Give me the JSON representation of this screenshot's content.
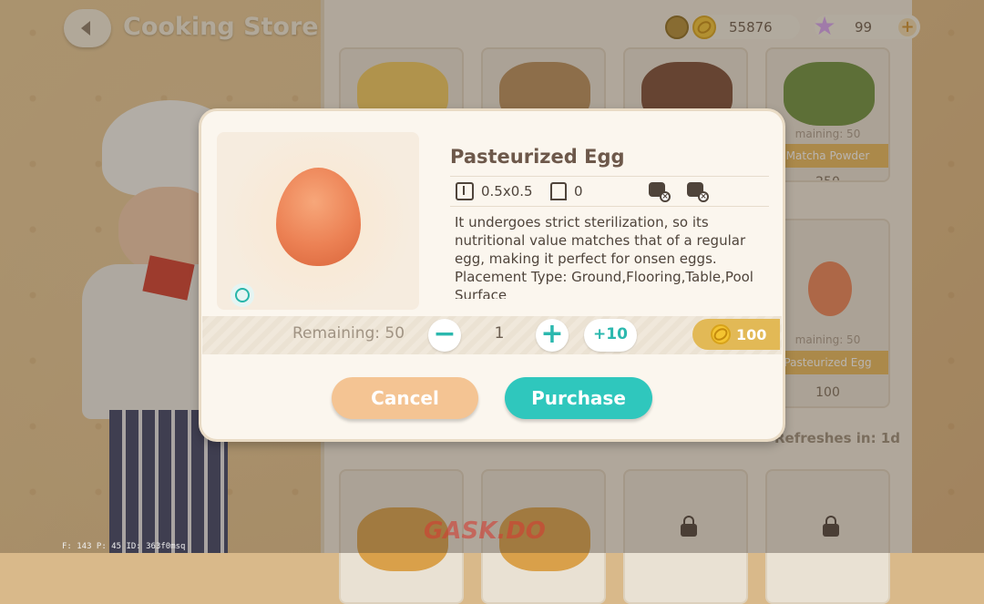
{
  "header": {
    "title": "Cooking Store"
  },
  "currency": {
    "coins": "55876",
    "stars": "99"
  },
  "shop": {
    "items": [
      {
        "name": "",
        "remaining": "",
        "price": ""
      },
      {
        "name": "",
        "remaining": "",
        "price": ""
      },
      {
        "name": "",
        "remaining": "",
        "price": ""
      },
      {
        "name": "Matcha Powder",
        "remaining": "maining: 50",
        "price": "250"
      },
      {
        "name": "Pasteurized Egg",
        "remaining": "maining: 50",
        "price": "100"
      }
    ],
    "refresh_label": "Refreshes in: 1d"
  },
  "modal": {
    "item_name": "Pasteurized Egg",
    "size": "0.5x0.5",
    "capacity": "0",
    "description": "It undergoes strict sterilization, so its nutritional value matches that of a regular egg, making it perfect for onsen eggs. Placement Type: Ground,Flooring,Table,Pool Surface",
    "remaining": "Remaining: 50",
    "quantity": "1",
    "plus_ten": "+10",
    "price": "100",
    "cancel": "Cancel",
    "purchase": "Purchase"
  },
  "debug": "F: 143    P: 45    ID: 363f0msq",
  "watermark": "GASK.DO",
  "colors": {
    "accent": "#2fc7bd",
    "cancel": "#f4c493",
    "price_tag": "#e2b956"
  }
}
